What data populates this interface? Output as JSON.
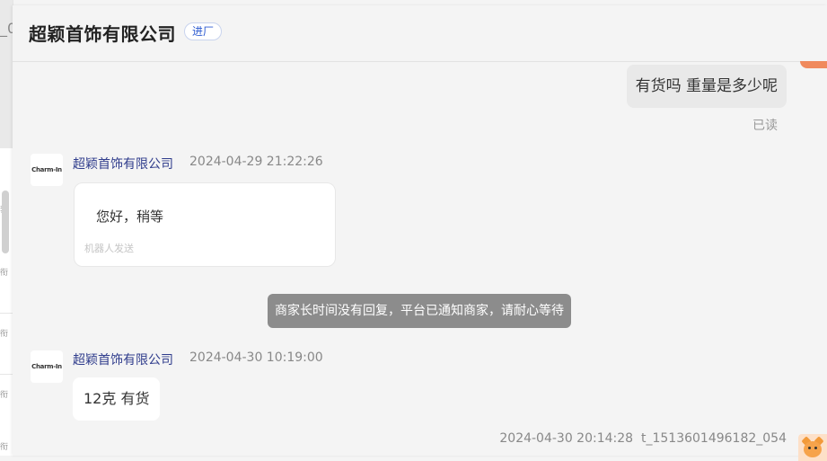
{
  "background_window": {
    "fragments": [
      "_0",
      "套",
      "衔",
      "衔",
      "衔",
      "衔",
      "衔"
    ]
  },
  "header": {
    "title": "超颖首饰有限公司",
    "badge": "进厂"
  },
  "messages": {
    "outgoing_text": "有货吗 重量是多少呢",
    "read_status": "已读",
    "first": {
      "avatar_logo": "Charm-In",
      "sender": "超颖首饰有限公司",
      "time": "2024-04-29 21:22:26",
      "text": "您好，稍等",
      "note": "机器人发送"
    },
    "system_notice": "商家长时间没有回复，平台已通知商家，请耐心等待",
    "second": {
      "avatar_logo": "Charm-In",
      "sender": "超颖首饰有限公司",
      "time": "2024-04-30 10:19:00",
      "text": "12克 有货"
    },
    "last_meta": {
      "time": "2024-04-30 20:14:28",
      "user": "t_1513601496182_054"
    }
  },
  "colors": {
    "accent_badge": "#2d5bd1",
    "sender_name": "#2f3c8c",
    "system_notice_bg": "#8c8c8c",
    "corner_accent": "#f08a5d"
  }
}
